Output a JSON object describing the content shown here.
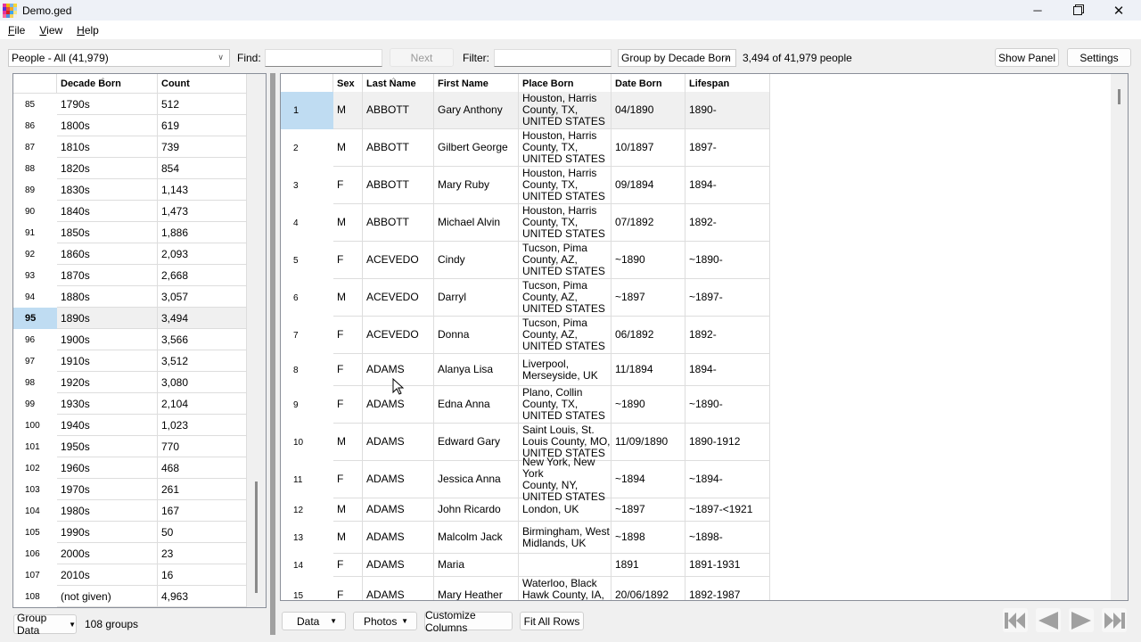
{
  "window": {
    "title": "Demo.ged",
    "icon": "app-grid-icon",
    "controls": [
      "minimize-icon",
      "restore-icon",
      "close-icon"
    ]
  },
  "menu": {
    "items": [
      {
        "label": "File",
        "accel": "F",
        "rest": "ile"
      },
      {
        "label": "View",
        "accel": "V",
        "rest": "iew"
      },
      {
        "label": "Help",
        "accel": "H",
        "rest": "elp"
      }
    ]
  },
  "toolbar": {
    "people_select": "People - All (41,979)",
    "find_label": "Find:",
    "find_value": "",
    "next_label": "Next",
    "filter_label": "Filter:",
    "filter_value": "",
    "group_select": "Group by Decade Born",
    "status": "3,494 of 41,979 people",
    "show_panel_label": "Show Panel",
    "settings_label": "Settings"
  },
  "group_grid": {
    "columns": [
      "Decade Born",
      "Count"
    ],
    "selected_row": 95,
    "rows": [
      {
        "n": "85",
        "decade": "1790s",
        "count": "512"
      },
      {
        "n": "86",
        "decade": "1800s",
        "count": "619"
      },
      {
        "n": "87",
        "decade": "1810s",
        "count": "739"
      },
      {
        "n": "88",
        "decade": "1820s",
        "count": "854"
      },
      {
        "n": "89",
        "decade": "1830s",
        "count": "1,143"
      },
      {
        "n": "90",
        "decade": "1840s",
        "count": "1,473"
      },
      {
        "n": "91",
        "decade": "1850s",
        "count": "1,886"
      },
      {
        "n": "92",
        "decade": "1860s",
        "count": "2,093"
      },
      {
        "n": "93",
        "decade": "1870s",
        "count": "2,668"
      },
      {
        "n": "94",
        "decade": "1880s",
        "count": "3,057"
      },
      {
        "n": "95",
        "decade": "1890s",
        "count": "3,494"
      },
      {
        "n": "96",
        "decade": "1900s",
        "count": "3,566"
      },
      {
        "n": "97",
        "decade": "1910s",
        "count": "3,512"
      },
      {
        "n": "98",
        "decade": "1920s",
        "count": "3,080"
      },
      {
        "n": "99",
        "decade": "1930s",
        "count": "2,104"
      },
      {
        "n": "100",
        "decade": "1940s",
        "count": "1,023"
      },
      {
        "n": "101",
        "decade": "1950s",
        "count": "770"
      },
      {
        "n": "102",
        "decade": "1960s",
        "count": "468"
      },
      {
        "n": "103",
        "decade": "1970s",
        "count": "261"
      },
      {
        "n": "104",
        "decade": "1980s",
        "count": "167"
      },
      {
        "n": "105",
        "decade": "1990s",
        "count": "50"
      },
      {
        "n": "106",
        "decade": "2000s",
        "count": "23"
      },
      {
        "n": "107",
        "decade": "2010s",
        "count": "16"
      },
      {
        "n": "108",
        "decade": "(not given)",
        "count": "4,963"
      }
    ],
    "group_data_label": "Group Data",
    "groups_count": "108 groups"
  },
  "people_grid": {
    "columns": [
      "Sex",
      "Last Name",
      "First Name",
      "Place Born",
      "Date Born",
      "Lifespan"
    ],
    "selected_row": 1,
    "rows": [
      {
        "n": "1",
        "sex": "M",
        "last": "ABBOTT",
        "first": "Gary Anthony",
        "place": "Houston, Harris\nCounty, TX,\nUNITED STATES",
        "date": "04/1890",
        "life": "1890-"
      },
      {
        "n": "2",
        "sex": "M",
        "last": "ABBOTT",
        "first": "Gilbert George",
        "place": "Houston, Harris\nCounty, TX,\nUNITED STATES",
        "date": "10/1897",
        "life": "1897-"
      },
      {
        "n": "3",
        "sex": "F",
        "last": "ABBOTT",
        "first": "Mary Ruby",
        "place": "Houston, Harris\nCounty, TX,\nUNITED STATES",
        "date": "09/1894",
        "life": "1894-"
      },
      {
        "n": "4",
        "sex": "M",
        "last": "ABBOTT",
        "first": "Michael Alvin",
        "place": "Houston, Harris\nCounty, TX,\nUNITED STATES",
        "date": "07/1892",
        "life": "1892-"
      },
      {
        "n": "5",
        "sex": "F",
        "last": "ACEVEDO",
        "first": "Cindy",
        "place": "Tucson, Pima\nCounty, AZ,\nUNITED STATES",
        "date": "~1890",
        "life": "~1890-"
      },
      {
        "n": "6",
        "sex": "M",
        "last": "ACEVEDO",
        "first": "Darryl",
        "place": "Tucson, Pima\nCounty, AZ,\nUNITED STATES",
        "date": "~1897",
        "life": "~1897-"
      },
      {
        "n": "7",
        "sex": "F",
        "last": "ACEVEDO",
        "first": "Donna",
        "place": "Tucson, Pima\nCounty, AZ,\nUNITED STATES",
        "date": "06/1892",
        "life": "1892-"
      },
      {
        "n": "8",
        "sex": "F",
        "last": "ADAMS",
        "first": "Alanya Lisa",
        "place": "Liverpool,\nMerseyside, UK",
        "date": "11/1894",
        "life": "1894-"
      },
      {
        "n": "9",
        "sex": "F",
        "last": "ADAMS",
        "first": "Edna Anna",
        "place": "Plano, Collin\nCounty, TX,\nUNITED STATES",
        "date": "~1890",
        "life": "~1890-"
      },
      {
        "n": "10",
        "sex": "M",
        "last": "ADAMS",
        "first": "Edward Gary",
        "place": "Saint Louis, St.\nLouis County, MO,\nUNITED STATES",
        "date": "11/09/1890",
        "life": "1890-1912"
      },
      {
        "n": "11",
        "sex": "F",
        "last": "ADAMS",
        "first": "Jessica Anna",
        "place": "New York, New York\nCounty, NY,\nUNITED STATES",
        "date": "~1894",
        "life": "~1894-"
      },
      {
        "n": "12",
        "sex": "M",
        "last": "ADAMS",
        "first": "John Ricardo",
        "place": "London, UK",
        "date": "~1897",
        "life": "~1897-<1921"
      },
      {
        "n": "13",
        "sex": "M",
        "last": "ADAMS",
        "first": "Malcolm Jack",
        "place": "Birmingham, West\nMidlands, UK",
        "date": "~1898",
        "life": "~1898-"
      },
      {
        "n": "14",
        "sex": "F",
        "last": "ADAMS",
        "first": "Maria",
        "place": "",
        "date": "1891",
        "life": "1891-1931"
      },
      {
        "n": "15",
        "sex": "F",
        "last": "ADAMS",
        "first": "Mary Heather",
        "place": "Waterloo, Black\nHawk County, IA,\nUNITED STATES",
        "date": "20/06/1892",
        "life": "1892-1987"
      }
    ]
  },
  "bottom_bar": {
    "data_label": "Data",
    "photos_label": "Photos",
    "customize_label": "Customize Columns",
    "fit_rows_label": "Fit All Rows",
    "nav": [
      "first-record-icon",
      "previous-record-icon",
      "next-record-icon",
      "last-record-icon"
    ]
  },
  "colors": {
    "selection_row_header": "#bfdcf2",
    "selected_row": "#f0f0f0",
    "border": "#8a8f99",
    "nav_icon": "#a0a0a0"
  }
}
